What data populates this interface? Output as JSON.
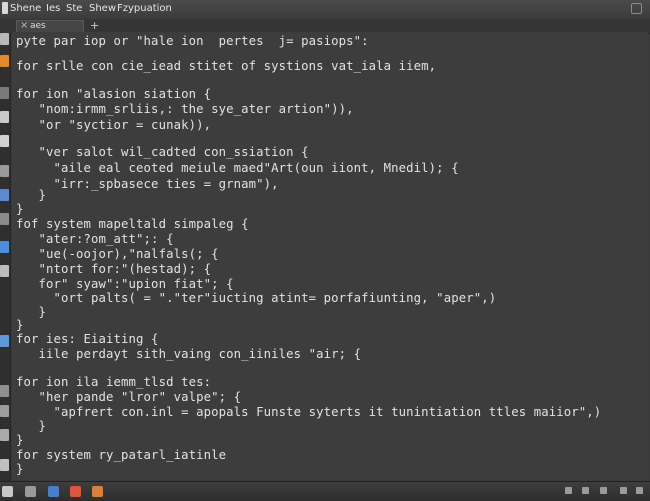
{
  "menu": {
    "items": [
      "Shene",
      "Ies",
      "Ste",
      "Shew",
      "Fzypuation"
    ]
  },
  "tab": {
    "close_glyph": "×",
    "label": "aes",
    "new_tab_glyph": "+"
  },
  "editor": {
    "lines": [
      "pyte par iop or \"hale ion  pertes  j= pasiops\":",
      "for srlle con cie_iead stitet of systions vat_iala iiem,",
      "for ion \"alasion siation {",
      "   \"nom:irmm_srliis,: the sye_ater artion\")),",
      "   \"or \"syctior = cunak)),",
      "   \"ver salot wil_cadted con_ssiation {",
      "     \"aile eal ceoted meiule maed\"Art(oun iiont, Mnedil); {",
      "     \"irr:_spbasece ties = grnam\"),",
      "   }",
      "}",
      "fof system mapeltald simpaleg {",
      "   \"ater:?om_att\";: {",
      "   \"ue(-oojor),\"nalfals(; {",
      "   \"ntort for:\"(hestad); {",
      "   for\" syaw\":\"upion fiat\"; {",
      "     \"ort palts( = \".\"ter\"iucting atint= porfafiunting, \"aper\",)",
      "   }",
      "}",
      "for ies: Eiaiting {",
      "   iile perdayt sith_vaing con_iiniles \"air; {",
      "for ion ila iemm_tlsd tes:",
      "   \"her pande \"lror\" valpe\"; {",
      "     \"apfrert con.inl = apopals Funste syterts it tunintiation ttles maiior\",)",
      "   }",
      "}",
      "for system ry_patarl_iatinle",
      "}"
    ]
  },
  "colors": {
    "background": "#3d3d3d",
    "text": "#e2e2e2",
    "chrome": "#353535"
  }
}
